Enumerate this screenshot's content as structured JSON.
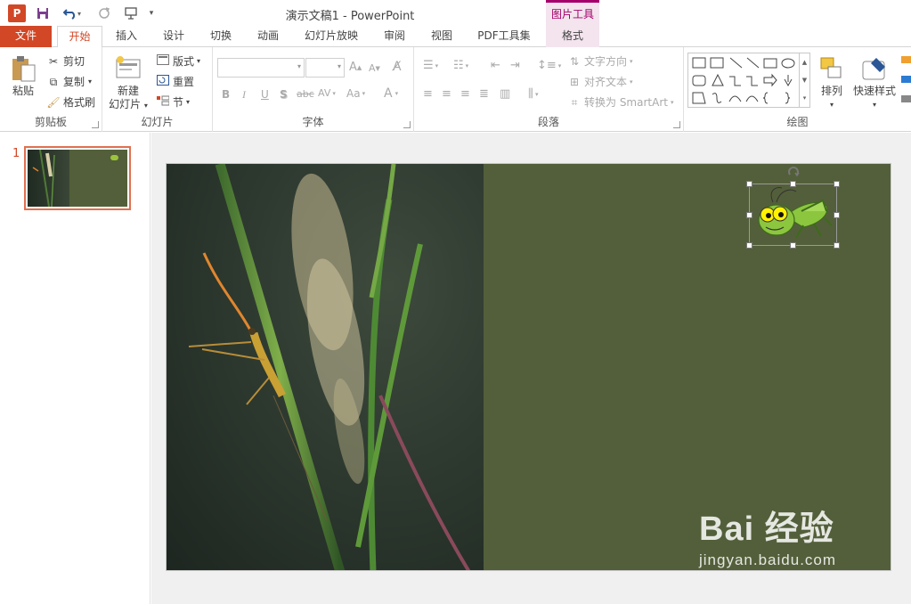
{
  "app": {
    "name": "PowerPoint",
    "icon_letter": "P",
    "brand_color": "#d24726",
    "doc_title": "演示文稿1 - PowerPoint"
  },
  "quick_access": {
    "icons": [
      "save-icon",
      "undo-icon",
      "redo-icon",
      "present-icon",
      "customize-icon"
    ]
  },
  "context_group": {
    "label": "图片工具",
    "color": "#a4006a"
  },
  "tabs": [
    {
      "label": "文件"
    },
    {
      "label": "开始"
    },
    {
      "label": "插入"
    },
    {
      "label": "设计"
    },
    {
      "label": "切换"
    },
    {
      "label": "动画"
    },
    {
      "label": "幻灯片放映"
    },
    {
      "label": "审阅"
    },
    {
      "label": "视图"
    },
    {
      "label": "PDF工具集"
    },
    {
      "label": "格式"
    }
  ],
  "ribbon": {
    "clipboard": {
      "label": "剪贴板",
      "paste": "粘贴",
      "cut": "剪切",
      "copy": "复制",
      "format_painter": "格式刷"
    },
    "slides": {
      "label": "幻灯片",
      "new_slide_line1": "新建",
      "new_slide_line2": "幻灯片",
      "layout": "版式",
      "reset": "重置",
      "section": "节"
    },
    "font": {
      "label": "字体",
      "font_name": "",
      "font_size": "",
      "bold": "B",
      "italic": "I",
      "underline": "U",
      "shadow": "S",
      "strikethrough": "abc",
      "spacing": "AV",
      "case": "Aa",
      "color": "A",
      "grow": "A",
      "shrink": "A"
    },
    "paragraph": {
      "label": "段落",
      "text_direction": "文字方向",
      "align_text": "对齐文本",
      "convert_smartart": "转换为 SmartArt"
    },
    "drawing": {
      "label": "绘图",
      "arrange": "排列",
      "quick_styles": "快速样式"
    }
  },
  "thumbnails": [
    {
      "number": "1"
    }
  ],
  "slide": {
    "bg_color": "#535f3a",
    "photo_subject": "grasshopper-on-grass-photo",
    "clipart": "cartoon-grasshopper",
    "selected": "cartoon-grasshopper"
  },
  "watermark": {
    "brand": "Bai 经验",
    "url": "jingyan.baidu.com"
  }
}
